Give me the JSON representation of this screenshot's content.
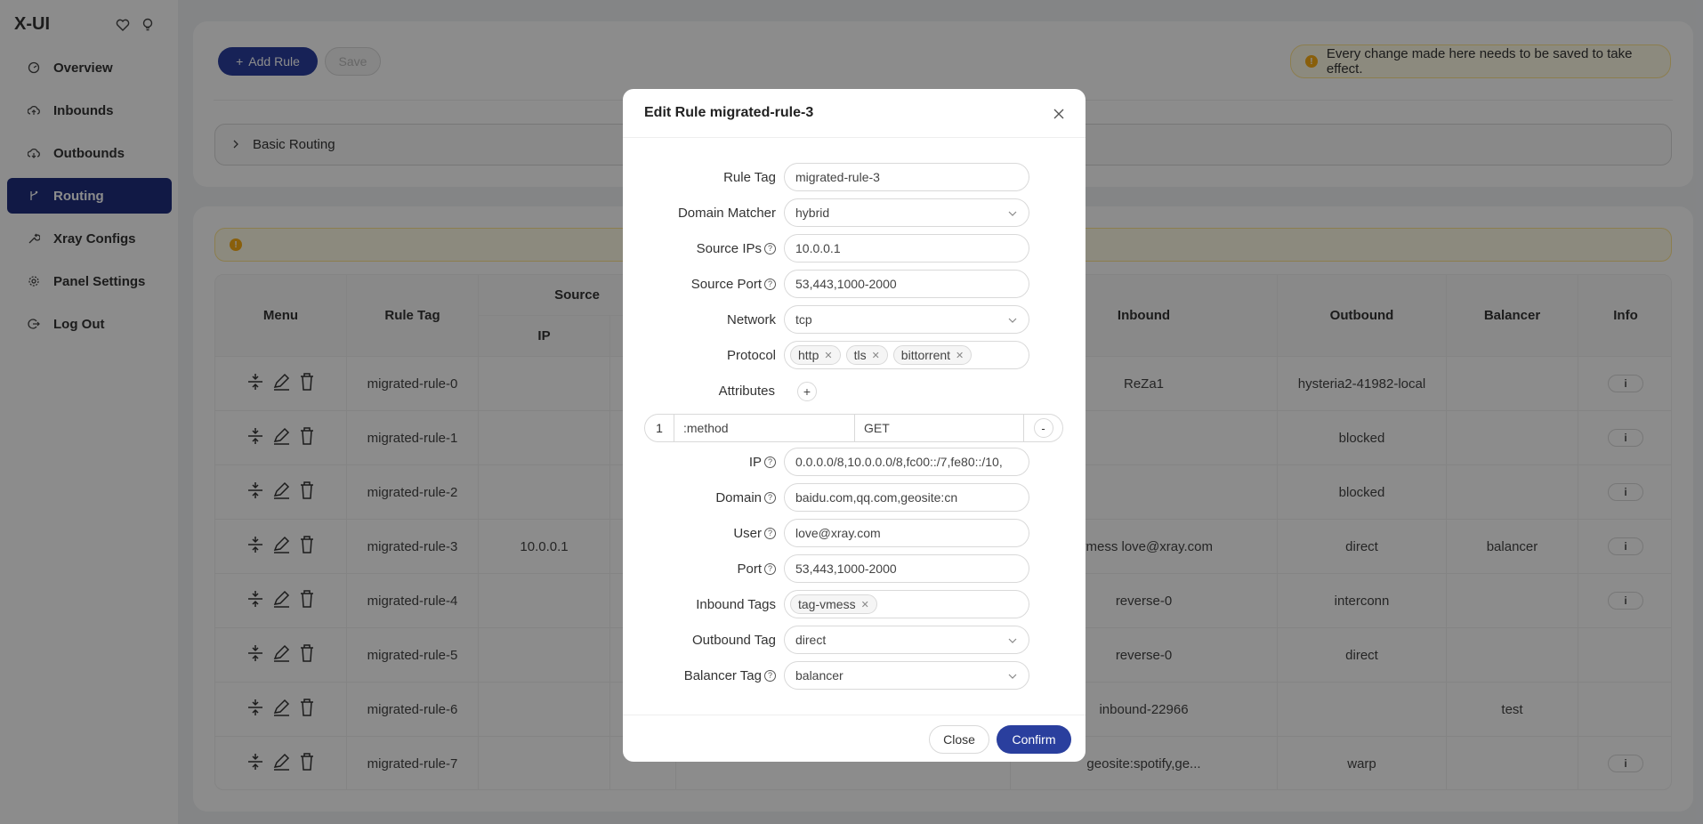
{
  "app": {
    "brand": "X-UI"
  },
  "sidebar": {
    "items": [
      {
        "label": "Overview",
        "icon": "dashboard-icon"
      },
      {
        "label": "Inbounds",
        "icon": "cloud-upload-icon"
      },
      {
        "label": "Outbounds",
        "icon": "cloud-download-icon"
      },
      {
        "label": "Routing",
        "icon": "branch-icon",
        "active": true
      },
      {
        "label": "Xray Configs",
        "icon": "tool-icon"
      },
      {
        "label": "Panel Settings",
        "icon": "gear-icon"
      },
      {
        "label": "Log Out",
        "icon": "logout-icon"
      }
    ]
  },
  "toolbar": {
    "add_label": "Add Rule",
    "save_label": "Save",
    "notice": "Every change made here needs to be saved to take effect."
  },
  "basic_routing": {
    "label": "Basic Routing"
  },
  "table": {
    "headers": {
      "menu": "Menu",
      "rule_tag": "Rule Tag",
      "source": "Source",
      "ip": "IP",
      "inbound": "Inbound",
      "outbound": "Outbound",
      "balancer": "Balancer",
      "info": "Info"
    },
    "rows": [
      {
        "tag": "migrated-rule-0",
        "ip": "",
        "inbound": "ReZa1",
        "outbound": "hysteria2-41982-local",
        "balancer": "",
        "info": "i"
      },
      {
        "tag": "migrated-rule-1",
        "ip": "",
        "inbound": "",
        "outbound": "blocked",
        "balancer": "",
        "info": "i"
      },
      {
        "tag": "migrated-rule-2",
        "ip": "",
        "inbound": "",
        "outbound": "blocked",
        "balancer": "",
        "info": "i"
      },
      {
        "tag": "migrated-rule-3",
        "ip": "10.0.0.1",
        "inbound": "-vmess love@xray.com",
        "outbound": "direct",
        "balancer": "balancer",
        "info": "i"
      },
      {
        "tag": "migrated-rule-4",
        "ip": "",
        "inbound": "reverse-0",
        "outbound": "interconn",
        "balancer": "",
        "info": "i"
      },
      {
        "tag": "migrated-rule-5",
        "ip": "",
        "inbound": "reverse-0",
        "outbound": "direct",
        "balancer": "",
        "info": ""
      },
      {
        "tag": "migrated-rule-6",
        "ip": "",
        "inbound": "inbound-22966",
        "outbound": "",
        "balancer": "test",
        "info": ""
      },
      {
        "tag": "migrated-rule-7",
        "ip": "",
        "inbound": "geosite:spotify,ge...",
        "outbound": "warp",
        "balancer": "",
        "info": "i"
      }
    ]
  },
  "modal": {
    "title": "Edit Rule migrated-rule-3",
    "fields": {
      "rule_tag": {
        "label": "Rule Tag",
        "value": "migrated-rule-3"
      },
      "domain_matcher": {
        "label": "Domain Matcher",
        "value": "hybrid"
      },
      "source_ips": {
        "label": "Source IPs",
        "value": "10.0.0.1"
      },
      "source_port": {
        "label": "Source Port",
        "value": "53,443,1000-2000"
      },
      "network": {
        "label": "Network",
        "value": "tcp"
      },
      "protocol": {
        "label": "Protocol",
        "tags": [
          "http",
          "tls",
          "bittorrent"
        ]
      },
      "attributes": {
        "label": "Attributes",
        "add": "+"
      },
      "attr_row": {
        "index": "1",
        "key": ":method",
        "value": "GET",
        "remove": "-"
      },
      "ip": {
        "label": "IP",
        "value": "0.0.0.0/8,10.0.0.0/8,fc00::/7,fe80::/10,"
      },
      "domain": {
        "label": "Domain",
        "value": "baidu.com,qq.com,geosite:cn"
      },
      "user": {
        "label": "User",
        "value": "love@xray.com"
      },
      "port": {
        "label": "Port",
        "value": "53,443,1000-2000"
      },
      "inbound_tags": {
        "label": "Inbound Tags",
        "tags": [
          "tag-vmess"
        ]
      },
      "outbound_tag": {
        "label": "Outbound Tag",
        "value": "direct"
      },
      "balancer_tag": {
        "label": "Balancer Tag",
        "value": "balancer"
      }
    },
    "close_label": "Close",
    "confirm_label": "Confirm"
  },
  "colors": {
    "accent": "#2a3f9e",
    "sidebar_active": "#1f2f7f",
    "warning": "#faad14",
    "warning_bg": "#fffbe6"
  }
}
